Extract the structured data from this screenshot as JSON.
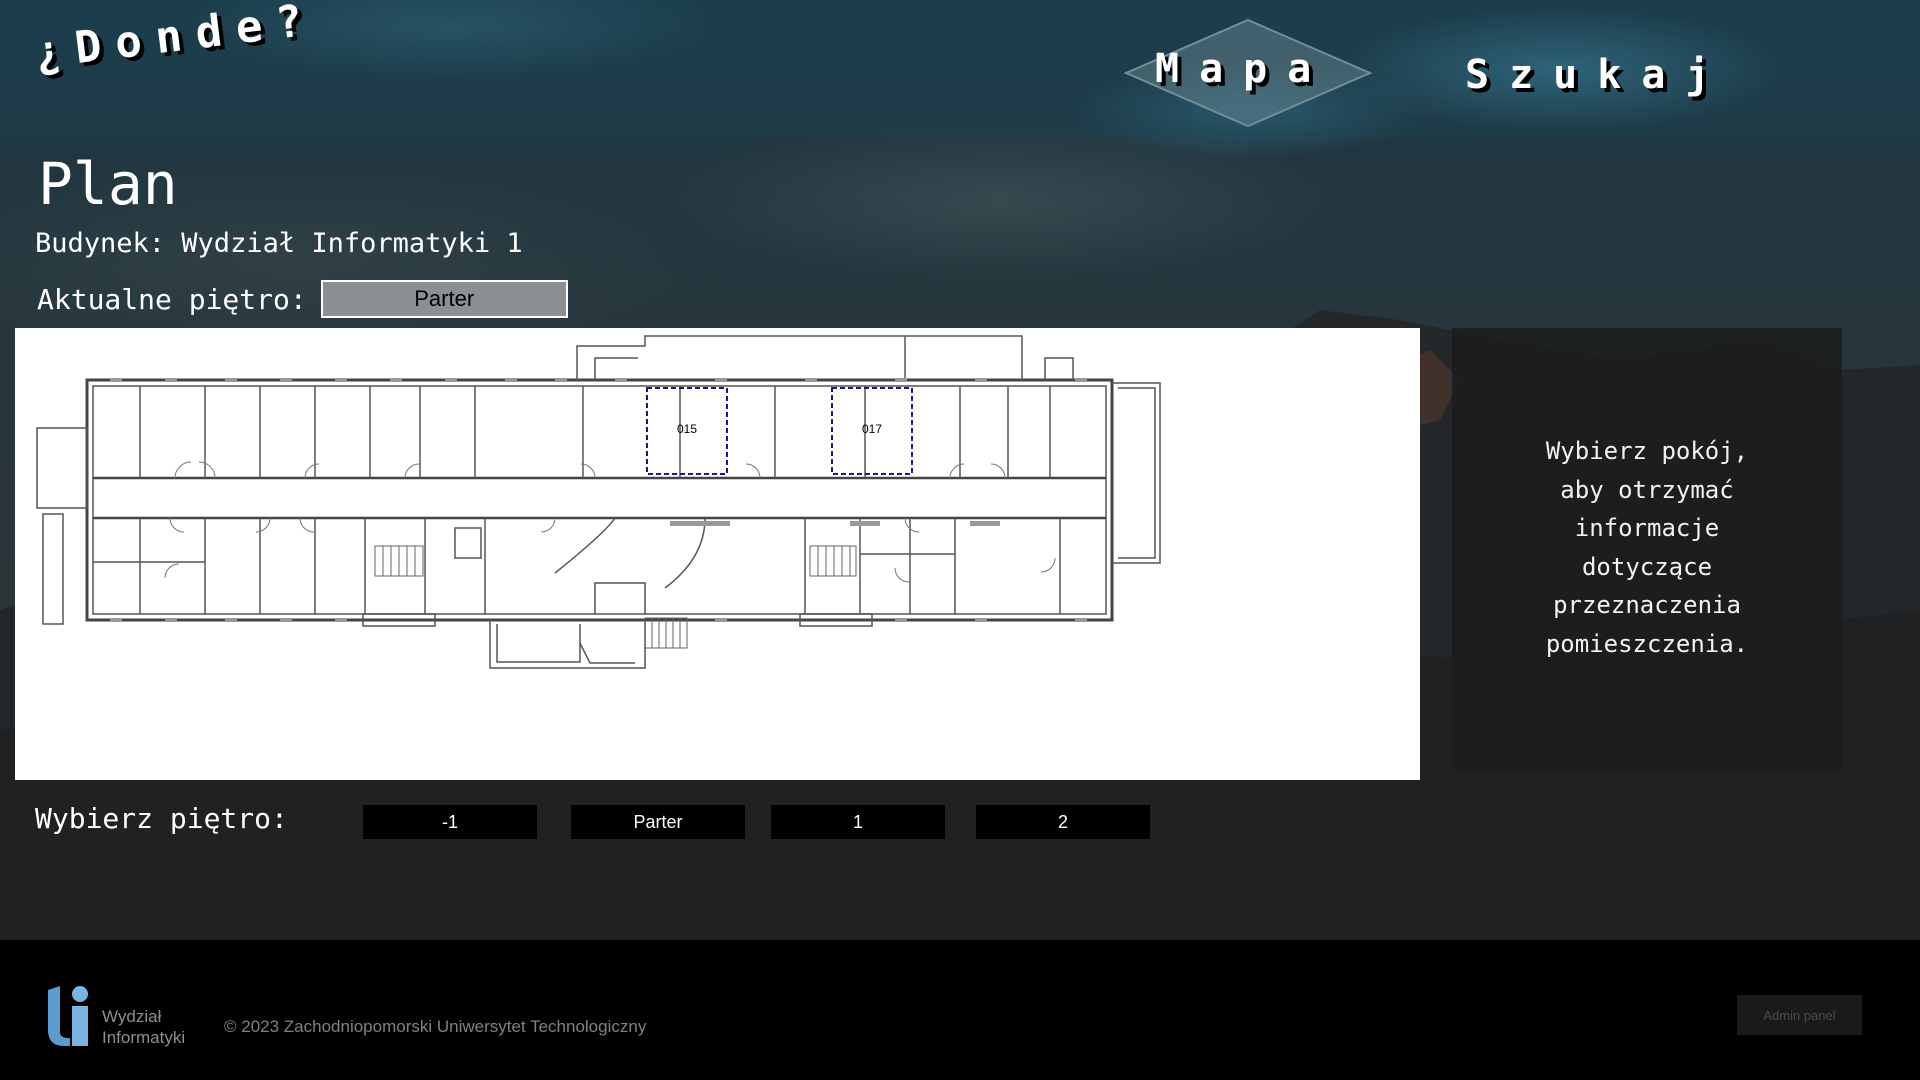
{
  "site": {
    "logo_text": "¿Donde?"
  },
  "nav": {
    "mapa": "Mapa",
    "szukaj": "Szukaj"
  },
  "page": {
    "title": "Plan",
    "building_text": "Budynek: Wydział Informatyki 1",
    "current_floor_label": "Aktualne piętro:",
    "current_floor_value": "Parter"
  },
  "plan": {
    "rooms": [
      {
        "id": "015",
        "label": "015",
        "highlighted": true
      },
      {
        "id": "017",
        "label": "017",
        "highlighted": true
      }
    ]
  },
  "info": {
    "text": "Wybierz pokój,\naby otrzymać\ninformacje\ndotyczące\nprzeznaczenia\npomieszczenia."
  },
  "floor_picker": {
    "label": "Wybierz piętro:",
    "buttons": [
      "-1",
      "Parter",
      "1",
      "2"
    ]
  },
  "footer": {
    "logo_text": "Wydział\nInformatyki",
    "copyright": "© 2023 Zachodniopomorski Uniwersytet Technologiczny",
    "admin_label": "Admin panel"
  },
  "colors": {
    "highlight": "#1a1a8c",
    "panel": "#1c1c1c",
    "floor_select": "#8c9094"
  }
}
